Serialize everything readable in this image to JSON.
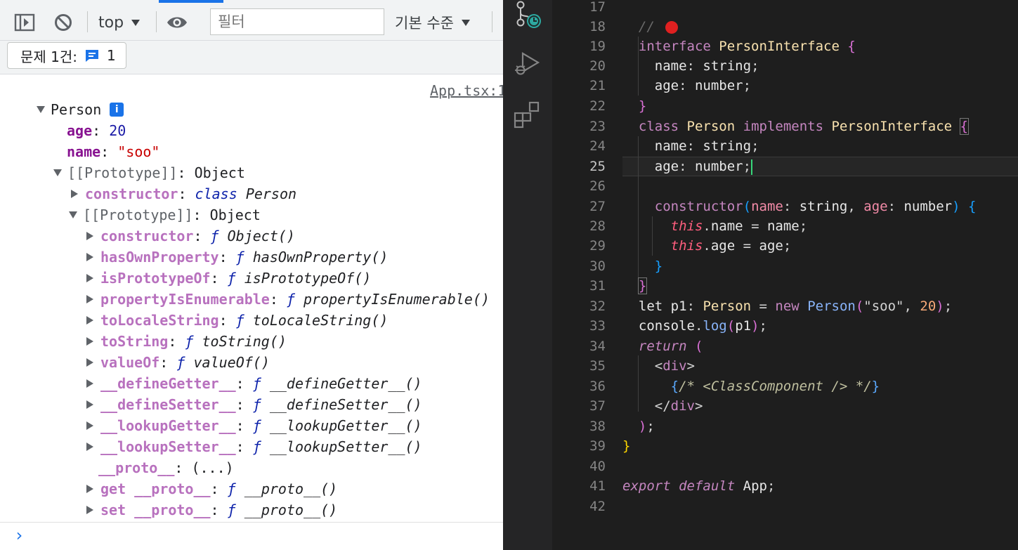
{
  "devtools": {
    "toolbar": {
      "context": "top",
      "filter_placeholder": "필터",
      "level": "기본 수준"
    },
    "issues": {
      "label": "문제 1건:",
      "count": "1"
    },
    "console": {
      "source_link": "App.tsx:1",
      "object_name": "Person",
      "info_badge": "i",
      "own": [
        {
          "key": "age",
          "value": "20"
        },
        {
          "key": "name",
          "value": "\"soo\""
        }
      ],
      "proto1": {
        "key": "[[Prototype]]",
        "value": "Object"
      },
      "proto1_constructor": {
        "key": "constructor",
        "kw": "class",
        "value": "Person"
      },
      "proto2": {
        "key": "[[Prototype]]",
        "value": "Object"
      },
      "proto2_items": [
        {
          "key": "constructor",
          "f": "ƒ",
          "value": "Object()"
        },
        {
          "key": "hasOwnProperty",
          "f": "ƒ",
          "value": "hasOwnProperty()"
        },
        {
          "key": "isPrototypeOf",
          "f": "ƒ",
          "value": "isPrototypeOf()"
        },
        {
          "key": "propertyIsEnumerable",
          "f": "ƒ",
          "value": "propertyIsEnumerable()"
        },
        {
          "key": "toLocaleString",
          "f": "ƒ",
          "value": "toLocaleString()"
        },
        {
          "key": "toString",
          "f": "ƒ",
          "value": "toString()"
        },
        {
          "key": "valueOf",
          "f": "ƒ",
          "value": "valueOf()"
        },
        {
          "key": "__defineGetter__",
          "f": "ƒ",
          "value": "__defineGetter__()"
        },
        {
          "key": "__defineSetter__",
          "f": "ƒ",
          "value": "__defineSetter__()"
        },
        {
          "key": "__lookupGetter__",
          "f": "ƒ",
          "value": "__lookupGetter__()"
        },
        {
          "key": "__lookupSetter__",
          "f": "ƒ",
          "value": "__lookupSetter__()"
        }
      ],
      "proto_getter": {
        "key": "__proto__",
        "value": "(...)"
      },
      "get_proto": {
        "prefix": "get",
        "key": "__proto__",
        "f": "ƒ",
        "value": "__proto__()"
      },
      "set_proto": {
        "prefix": "set",
        "key": "__proto__",
        "f": "ƒ",
        "value": "__proto__()"
      },
      "prompt": "›"
    }
  },
  "editor": {
    "current_line": "25",
    "line_numbers": [
      "17",
      "18",
      "19",
      "20",
      "21",
      "22",
      "23",
      "24",
      "25",
      "26",
      "27",
      "28",
      "29",
      "30",
      "31",
      "32",
      "33",
      "34",
      "35",
      "36",
      "37",
      "38",
      "39",
      "40",
      "41",
      "42"
    ],
    "tokens": {
      "l18_comment": "// ",
      "interface_kw": "interface",
      "person_interface": "PersonInterface",
      "name": "name",
      "age": "age",
      "string": "string",
      "number": "number",
      "class_kw": "class",
      "person": "Person",
      "implements_kw": "implements",
      "constructor": "constructor",
      "this": "this",
      "let_kw": "let",
      "p1": "p1",
      "new_kw": "new",
      "soo": "\"soo\"",
      "twenty": "20",
      "console": "console",
      "log": "log",
      "return_kw": "return",
      "div": "div",
      "jsx_comment": "/* <ClassComponent /> */",
      "export_kw": "export",
      "default_kw": "default",
      "app": "App"
    }
  },
  "icons": {
    "devtools": [
      "sidebar-toggle-icon",
      "clear-console-icon",
      "dropdown-arrow-icon",
      "eye-icon",
      "message-icon"
    ],
    "activity_bar": [
      "source-control-icon",
      "run-debug-icon",
      "extensions-icon"
    ]
  },
  "colors": {
    "accent": "#1a73e8",
    "cursor": "#37d67a",
    "breakpoint": "#e02020"
  }
}
